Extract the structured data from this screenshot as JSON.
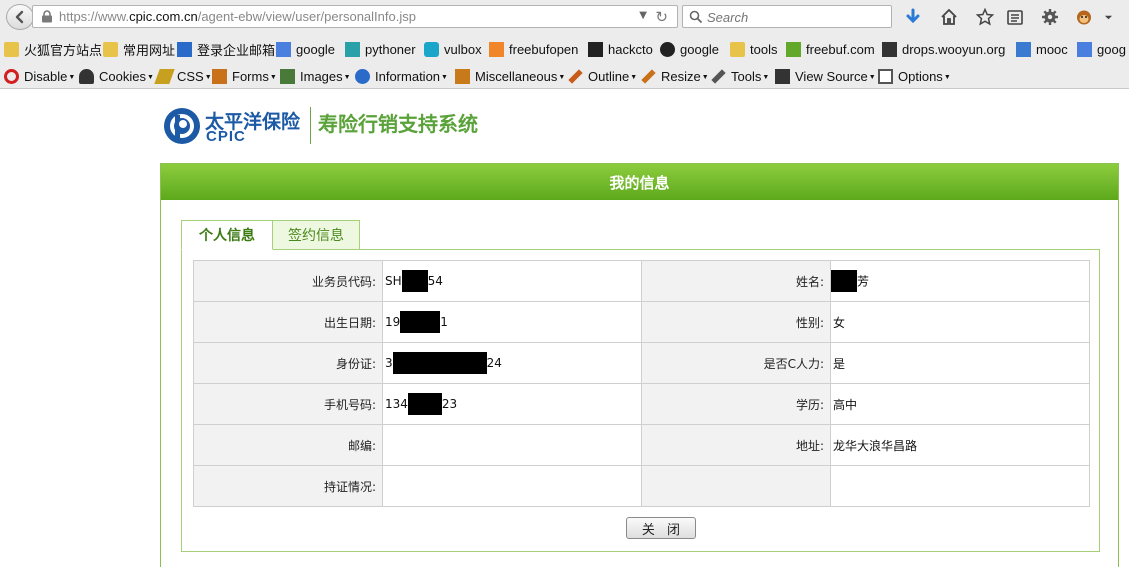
{
  "browser": {
    "url_prefix": "https://www.",
    "url_domain": "cpic.com.cn",
    "url_path": "/agent-ebw/view/user/personalInfo.jsp",
    "search_placeholder": "Search",
    "bookmarks": [
      {
        "label": "火狐官方站点",
        "icon": "folder-icon",
        "color": "#e8c34a"
      },
      {
        "label": "常用网址",
        "icon": "folder-icon",
        "color": "#e8c34a"
      },
      {
        "label": "登录企业邮箱",
        "icon": "mail-icon",
        "color": "#2a6ac8"
      },
      {
        "label": "google",
        "icon": "google-icon",
        "color": "#4a7fe0"
      },
      {
        "label": "pythoner",
        "icon": "python-icon",
        "color": "#2aa0a8"
      },
      {
        "label": "vulbox",
        "icon": "vulbox-icon",
        "color": "#1aa6c8"
      },
      {
        "label": "freebufopen",
        "icon": "freebuf-icon",
        "color": "#f0852a"
      },
      {
        "label": "hackcto",
        "icon": "hackcto-icon",
        "color": "#222222"
      },
      {
        "label": "google",
        "icon": "github-icon",
        "color": "#222222"
      },
      {
        "label": "tools",
        "icon": "folder-icon",
        "color": "#e8c34a"
      },
      {
        "label": "freebuf.com",
        "icon": "freebuf-f-icon",
        "color": "#62a82a"
      },
      {
        "label": "drops.wooyun.org",
        "icon": "wooyun-icon",
        "color": "#333333"
      },
      {
        "label": "mooc",
        "icon": "mooc-icon",
        "color": "#3a7ad0"
      },
      {
        "label": "goog",
        "icon": "google-icon",
        "color": "#4a7fe0"
      }
    ],
    "devtools": [
      {
        "label": "Disable",
        "icon": "disable-icon",
        "color": "#d22020"
      },
      {
        "label": "Cookies",
        "icon": "cookies-icon",
        "color": "#333333"
      },
      {
        "label": "CSS",
        "icon": "css-icon",
        "color": "#c8a020"
      },
      {
        "label": "Forms",
        "icon": "forms-icon",
        "color": "#c8701a"
      },
      {
        "label": "Images",
        "icon": "images-icon",
        "color": "#4a7a3a"
      },
      {
        "label": "Information",
        "icon": "info-icon",
        "color": "#2a6ac8"
      },
      {
        "label": "Miscellaneous",
        "icon": "misc-icon",
        "color": "#c87a1a"
      },
      {
        "label": "Outline",
        "icon": "outline-icon",
        "color": "#c85a1a"
      },
      {
        "label": "Resize",
        "icon": "resize-icon",
        "color": "#c8701a"
      },
      {
        "label": "Tools",
        "icon": "tools-icon",
        "color": "#555555"
      },
      {
        "label": "View Source",
        "icon": "view-source-icon",
        "color": "#333333"
      },
      {
        "label": "Options",
        "icon": "options-icon",
        "color": "#555555"
      }
    ],
    "toolbar_icons": [
      "download-icon",
      "home-icon",
      "star-icon",
      "reader-icon",
      "gear-icon",
      "monkey-icon",
      "menu-arrow-icon"
    ]
  },
  "logo": {
    "company_cn": "太平洋保险",
    "company_en": "CPIC",
    "system_name": "寿险行销支持系统",
    "brand_color": "#1c5aa6",
    "accent_color": "#5aa23a"
  },
  "panel": {
    "title": "我的信息",
    "tabs": [
      {
        "label": "个人信息",
        "active": true
      },
      {
        "label": "签约信息",
        "active": false
      }
    ]
  },
  "info": {
    "rows": [
      {
        "left_label": "业务员代码:",
        "left_pre": "SH",
        "left_post": "54",
        "left_redacted": true,
        "right_label": "姓名:",
        "right_pre": "",
        "right_post": "芳",
        "right_redacted": true
      },
      {
        "left_label": "出生日期:",
        "left_pre": "19",
        "left_post": "1",
        "left_redacted": true,
        "right_label": "性别:",
        "right_pre": "女",
        "right_post": "",
        "right_redacted": false
      },
      {
        "left_label": "身份证:",
        "left_pre": "3",
        "left_post": "24",
        "left_redacted": true,
        "right_label": "是否C人力:",
        "right_pre": "是",
        "right_post": "",
        "right_redacted": false
      },
      {
        "left_label": "手机号码:",
        "left_pre": "134",
        "left_post": "23",
        "left_redacted": true,
        "right_label": "学历:",
        "right_pre": "高中",
        "right_post": "",
        "right_redacted": false
      },
      {
        "left_label": "邮编:",
        "left_pre": "",
        "left_post": "",
        "left_redacted": false,
        "right_label": "地址:",
        "right_pre": "龙华大浪华昌路",
        "right_post": "",
        "right_redacted": false
      },
      {
        "left_label": "持证情况:",
        "left_pre": "",
        "left_post": "",
        "left_redacted": false,
        "right_label": "",
        "right_pre": "",
        "right_post": "",
        "right_redacted": false
      }
    ],
    "close_label": "关 闭"
  }
}
